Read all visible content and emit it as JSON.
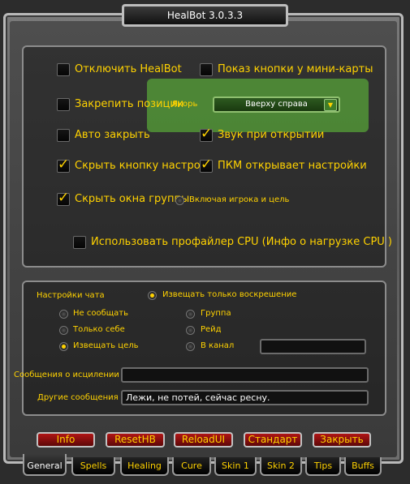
{
  "window": {
    "title": "HealBot 3.0.3.3"
  },
  "general": {
    "disable_healbot": {
      "label": "Отключить HealBot",
      "checked": false
    },
    "minimap_button": {
      "label": "Показ кнопки у мини-карты",
      "checked": false
    },
    "lock_position": {
      "label": "Закрепить позиции",
      "checked": false
    },
    "anchor": {
      "label": "Якорь",
      "value": "Вверху справа"
    },
    "auto_close": {
      "label": "Авто закрыть",
      "checked": false
    },
    "sound_on_open": {
      "label": "Звук при открытии",
      "checked": true
    },
    "hide_options_button": {
      "label": "Скрыть кнопку настроек",
      "checked": true
    },
    "rmb_opens_options": {
      "label": "ПКМ открывает настройки",
      "checked": true
    },
    "hide_party_frames": {
      "label": "Скрыть окна группы",
      "checked": true
    },
    "include_player_target": {
      "label": "Включая игрока и цель",
      "selected": false
    },
    "cpu_profiler": {
      "label": "Использовать профайлер CPU (Инфо о нагрузке CPU )",
      "checked": false
    }
  },
  "chat": {
    "section_label": "Настройки чата",
    "notify_res_only": {
      "label": "Извещать только воскрешение",
      "selected": true
    },
    "options": [
      {
        "label": "Не сообщать",
        "selected": false
      },
      {
        "label": "Только себе",
        "selected": false
      },
      {
        "label": "Извещать цель",
        "selected": true
      },
      {
        "label": "Группа",
        "selected": false
      },
      {
        "label": "Рейд",
        "selected": false
      },
      {
        "label": "В канал",
        "selected": false
      }
    ],
    "channel_value": "",
    "heal_messages": {
      "label": "Сообщения о исцилении",
      "value": ""
    },
    "other_messages": {
      "label": "Другие сообщения",
      "value": "Лежи, не потей, сейчас ресну."
    }
  },
  "buttons": [
    "Info",
    "ResetHB",
    "ReloadUI",
    "Стандарт",
    "Закрыть"
  ],
  "tabs": [
    "General",
    "Spells",
    "Healing",
    "Cure",
    "Skin 1",
    "Skin 2",
    "Tips",
    "Buffs"
  ],
  "active_tab": "General",
  "icons": {
    "dropdown_arrow": "chevron-down-icon",
    "check": "checkmark-icon"
  },
  "colors": {
    "label": "#ffd200",
    "highlight": "#57a338",
    "button": "#a01010"
  }
}
